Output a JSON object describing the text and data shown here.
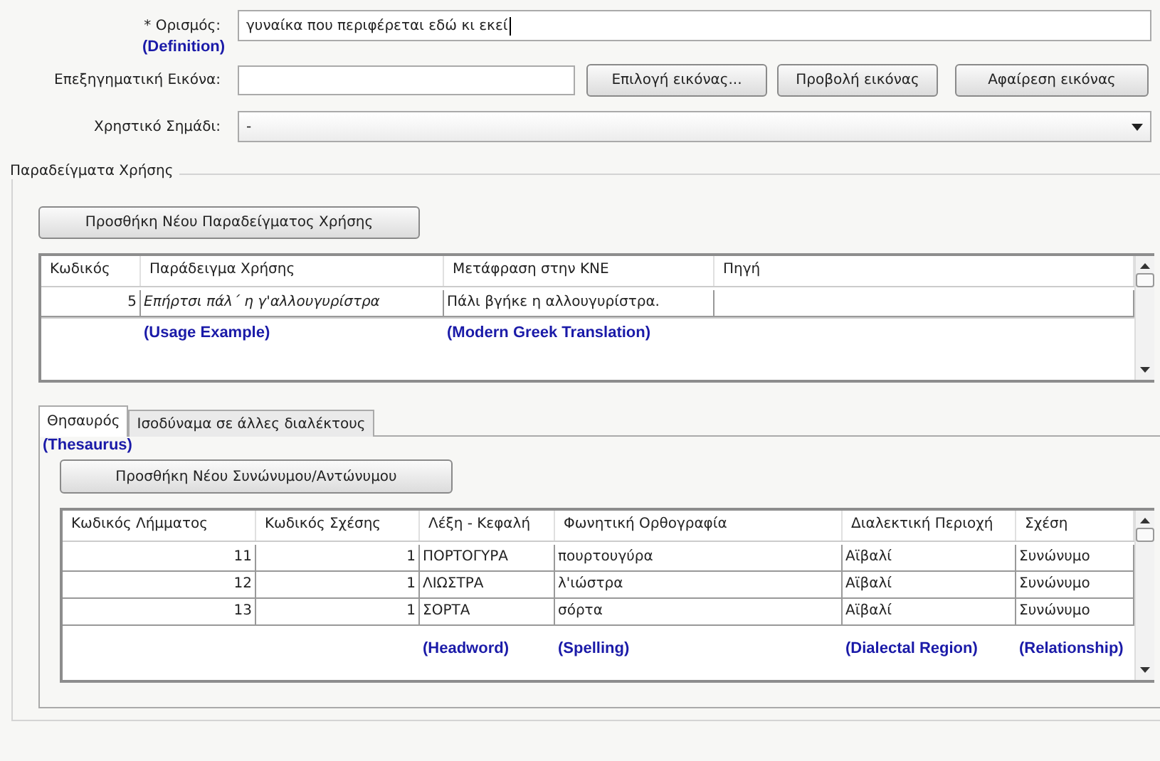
{
  "definition": {
    "label": "* Ορισμός:",
    "value": "γυναίκα που περιφέρεται εδώ κι εκεί",
    "annotation": "(Definition)"
  },
  "image": {
    "label": "Επεξηγηματική Εικόνα:",
    "buttons": [
      "Επιλογή εικόνας...",
      "Προβολή εικόνας",
      "Αφαίρεση εικόνας"
    ]
  },
  "usage_mark": {
    "label": "Χρηστικό Σημάδι:",
    "value": "-"
  },
  "examples": {
    "title": "Παραδείγματα Χρήσης",
    "add_button": "Προσθήκη Νέου Παραδείγματος Χρήσης",
    "columns": [
      {
        "label": "Κωδικός"
      },
      {
        "label": "Παράδειγμα Χρήσης",
        "annotation": "(Usage Example)"
      },
      {
        "label": "Μετάφραση στην ΚΝΕ",
        "annotation": "(Modern Greek Translation)"
      },
      {
        "label": "Πηγή"
      }
    ],
    "rows": [
      [
        "5",
        "Επήρτσι πάλ΄ η γ'αλλουγυρίστρα",
        "Πάλι βγήκε η αλλουγυρίστρα.",
        ""
      ]
    ]
  },
  "tabs": [
    {
      "label": "Θησαυρός",
      "selected": true,
      "annotation": "(Thesaurus)"
    },
    {
      "label": "Ισοδύναμα σε άλλες διαλέκτους",
      "selected": false
    }
  ],
  "thesaurus": {
    "add_button": "Προσθήκη Νέου Συνώνυμου/Αντώνυμου",
    "columns": [
      {
        "label": "Κωδικός Λήμματος"
      },
      {
        "label": "Κωδικός Σχέσης"
      },
      {
        "label": "Λέξη - Κεφαλή",
        "annotation": "(Headword)"
      },
      {
        "label": "Φωνητική Ορθογραφία",
        "annotation": "(Spelling)"
      },
      {
        "label": "Διαλεκτική Περιοχή",
        "annotation": "(Dialectal Region)"
      },
      {
        "label": "Σχέση",
        "annotation": "(Relationship)"
      }
    ],
    "entries": [
      {
        "lemma_code": "11",
        "relation_code": "1",
        "headword": "ΠΟΡΤΟΓΥΡΑ",
        "spelling": "πουρτουγύρα",
        "region": "Αϊβαλί",
        "relation": "Συνώνυμο"
      },
      {
        "lemma_code": "12",
        "relation_code": "1",
        "headword": "ΛΙΩΣΤΡΑ",
        "spelling": "λ'ιώστρα",
        "region": "Αϊβαλί",
        "relation": "Συνώνυμο"
      },
      {
        "lemma_code": "13",
        "relation_code": "1",
        "headword": "ΣΟΡΤΑ",
        "spelling": "σόρτα",
        "region": "Αϊβαλί",
        "relation": "Συνώνυμο"
      }
    ]
  }
}
